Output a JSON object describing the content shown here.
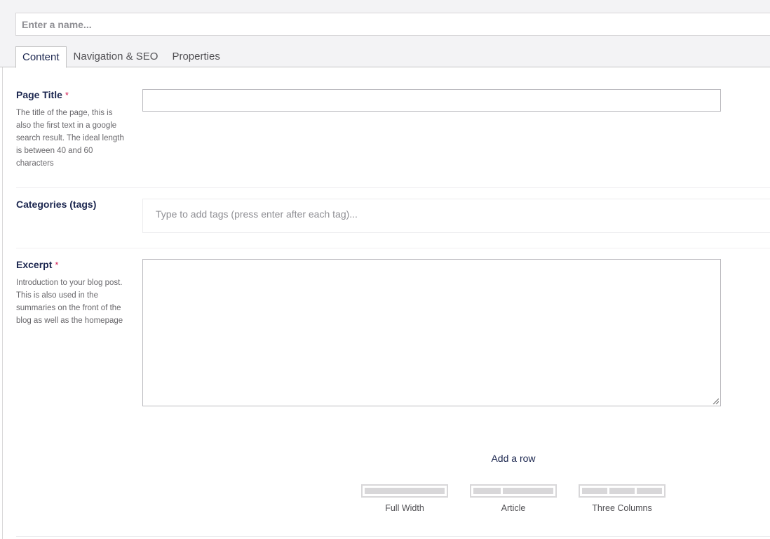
{
  "header": {
    "name_placeholder": "Enter a name...",
    "tabs": [
      {
        "label": "Content",
        "active": true
      },
      {
        "label": "Navigation & SEO",
        "active": false
      },
      {
        "label": "Properties",
        "active": false
      }
    ]
  },
  "properties": {
    "page_title": {
      "label": "Page Title",
      "required_mark": "*",
      "description": "The title of the page, this is also the first text in a google search result. The ideal length is between 40 and 60 characters",
      "value": ""
    },
    "categories": {
      "label": "Categories (tags)",
      "placeholder": "Type to add tags (press enter after each tag)..."
    },
    "excerpt": {
      "label": "Excerpt",
      "required_mark": "*",
      "description": "Introduction to your blog post. This is also used in the summaries on the front of the blog as well as the homepage",
      "value": ""
    }
  },
  "grid": {
    "add_row_title": "Add a row",
    "layouts": [
      {
        "name": "Full Width",
        "columns": 1
      },
      {
        "name": "Article",
        "columns": 2
      },
      {
        "name": "Three Columns",
        "columns": 3
      }
    ]
  },
  "colors": {
    "required": "#d42054",
    "header_bg": "#f3f3f5",
    "label_text": "#1b264f"
  },
  "icons": {
    "resize": "resize-grip-icon"
  }
}
